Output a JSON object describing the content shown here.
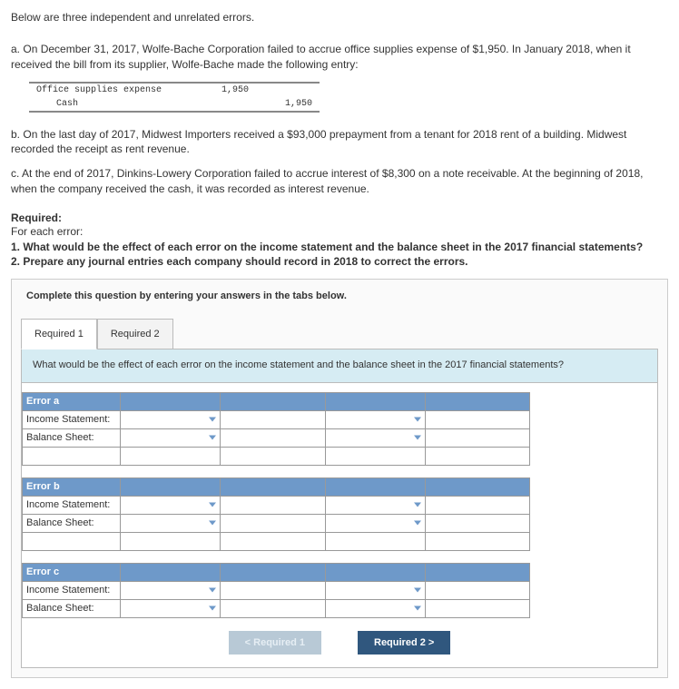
{
  "intro": "Below are three independent and unrelated errors.",
  "items": {
    "a": {
      "prefix": "a.",
      "text": "On December 31, 2017, Wolfe-Bache Corporation failed to accrue office supplies expense of $1,950. In January 2018, when it received the bill from its supplier, Wolfe-Bache made the following entry:"
    },
    "b": {
      "prefix": "b.",
      "text": "On the last day of 2017, Midwest Importers received a $93,000 prepayment from a tenant for 2018 rent of a building. Midwest recorded the receipt as rent revenue."
    },
    "c": {
      "prefix": "c.",
      "text": "At the end of 2017, Dinkins-Lowery Corporation failed to accrue interest of $8,300 on a note receivable. At the beginning of 2018, when the company received the cash, it was recorded as interest revenue."
    }
  },
  "journal": {
    "debit_acct": "Office supplies expense",
    "credit_acct": "Cash",
    "debit_amt": "1,950",
    "credit_amt": "1,950"
  },
  "required": {
    "title": "Required:",
    "lead": "For each error:",
    "q1": "1. What would be the effect of each error on the income statement and the balance sheet in the 2017 financial statements?",
    "q2": "2. Prepare any journal entries each company should record in 2018 to correct the errors."
  },
  "instruction": "Complete this question by entering your answers in the tabs below.",
  "tabs": {
    "r1": "Required 1",
    "r2": "Required 2"
  },
  "panel_prompt": "What would be the effect of each error on the income statement and the balance sheet in the 2017 financial statements?",
  "errors": {
    "a": {
      "title": "Error a",
      "row1": "Income Statement:",
      "row2": "Balance Sheet:"
    },
    "b": {
      "title": "Error b",
      "row1": "Income Statement:",
      "row2": "Balance Sheet:"
    },
    "c": {
      "title": "Error c",
      "row1": "Income Statement:",
      "row2": "Balance Sheet:"
    }
  },
  "nav": {
    "prev": "Required 1",
    "next": "Required 2"
  }
}
